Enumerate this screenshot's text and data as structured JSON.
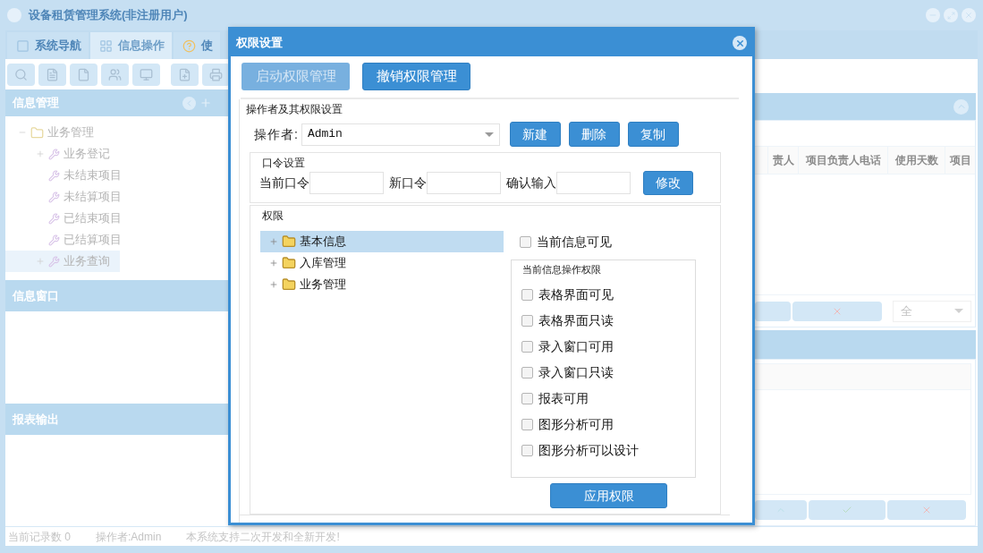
{
  "window": {
    "title": "设备租赁管理系统(非注册用户)"
  },
  "tabs": [
    {
      "label": "系统导航",
      "selected": false
    },
    {
      "label": "信息操作",
      "selected": true
    },
    {
      "label": "使",
      "selected": false
    }
  ],
  "sidebar": {
    "panels": [
      {
        "title": "信息管理",
        "tree": [
          {
            "label": "业务管理",
            "expanded": true,
            "selected": false,
            "children": [
              {
                "label": "业务登记",
                "expandable": true,
                "selected": false
              },
              {
                "label": "未结束项目",
                "expandable": false,
                "selected": false
              },
              {
                "label": "未结算项目",
                "expandable": false,
                "selected": false
              },
              {
                "label": "已结束项目",
                "expandable": false,
                "selected": false
              },
              {
                "label": "已结算项目",
                "expandable": false,
                "selected": false
              },
              {
                "label": "业务查询",
                "expandable": true,
                "selected": true
              }
            ]
          }
        ]
      },
      {
        "title": "信息窗口"
      },
      {
        "title": "报表输出"
      }
    ]
  },
  "table": {
    "columns": [
      "责人",
      "项目负责人电话",
      "使用天数",
      "项目"
    ]
  },
  "filter_select": {
    "value": "全"
  },
  "status_bar": [
    "当前记录数 0",
    "操作者:Admin",
    "本系统支持二次开发和全新开发!"
  ],
  "dialog": {
    "title": "权限设置",
    "top_buttons": [
      {
        "label": "启动权限管理",
        "disabled": true
      },
      {
        "label": "撤销权限管理",
        "disabled": false
      }
    ],
    "operator_section": {
      "title": "操作者及其权限设置",
      "label": "操作者:",
      "value": "Admin",
      "buttons": [
        "新建",
        "删除",
        "复制"
      ]
    },
    "password": {
      "title": "口令设置",
      "fields": [
        {
          "label": "当前口令"
        },
        {
          "label": "新口令"
        },
        {
          "label": "确认输入"
        }
      ],
      "button": "修改"
    },
    "permissions": {
      "title": "权限",
      "tree": [
        {
          "label": "基本信息",
          "selected": true
        },
        {
          "label": "入库管理",
          "selected": false
        },
        {
          "label": "业务管理",
          "selected": false
        }
      ],
      "visible": {
        "label": "当前信息可见",
        "checked": false
      },
      "ops": {
        "title": "当前信息操作权限",
        "items": [
          {
            "label": "表格界面可见",
            "checked": false
          },
          {
            "label": "表格界面只读",
            "checked": false
          },
          {
            "label": "录入窗口可用",
            "checked": false
          },
          {
            "label": "录入窗口只读",
            "checked": false
          },
          {
            "label": "报表可用",
            "checked": false
          },
          {
            "label": "图形分析可用",
            "checked": false
          },
          {
            "label": "图形分析可以设计",
            "checked": false
          }
        ]
      },
      "apply_button": "应用权限"
    }
  }
}
